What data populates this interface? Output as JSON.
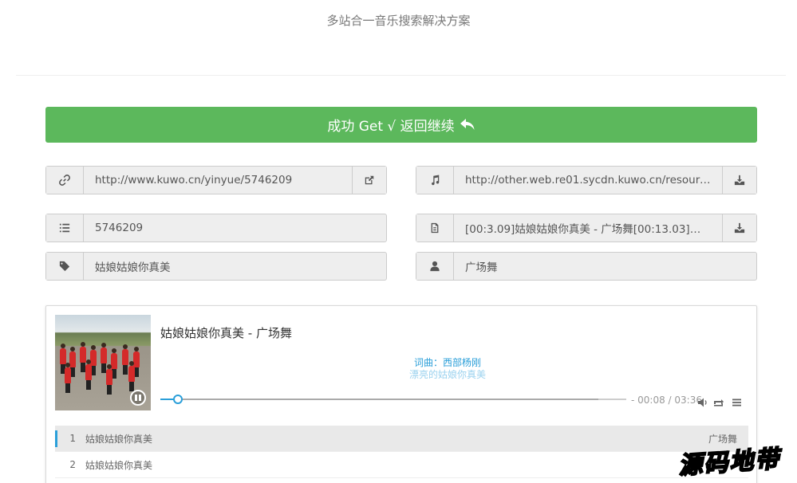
{
  "page": {
    "subtitle": "多站合一音乐搜索解决方案"
  },
  "success_button": {
    "label": "成功 Get √ 返回继续"
  },
  "fields": {
    "source_link": {
      "value": "http://www.kuwo.cn/yinyue/5746209"
    },
    "audio_url": {
      "value": "http://other.web.re01.sycdn.kuwo.cn/resource/n..."
    },
    "song_id": {
      "value": "5746209"
    },
    "lyrics": {
      "value": "[00:3.09]姑娘姑娘你真美 - 广场舞[00:13.03]词曲..."
    },
    "song_name": {
      "value": "姑娘姑娘你真美"
    },
    "artist": {
      "value": "广场舞"
    }
  },
  "player": {
    "title": "姑娘姑娘你真美 - 广场舞",
    "lyric_current": "词曲：西部杨刚",
    "lyric_next": "漂亮的姑娘你真美",
    "time": "- 00:08 / 03:36",
    "progress_played": 0.038,
    "progress_loaded": 0.94
  },
  "playlist": [
    {
      "num": "1",
      "title": "姑娘姑娘你真美",
      "artist": "广场舞",
      "active": true
    },
    {
      "num": "2",
      "title": "姑娘姑娘你真美",
      "artist": "",
      "active": false
    }
  ],
  "watermark": "源码地带",
  "colors": {
    "success": "#5cb85c",
    "accent": "#2b9fd9"
  },
  "icons": {
    "source_link": "link-icon",
    "source_link_action": "external-link-icon",
    "audio_url": "music-icon",
    "audio_url_action": "download-icon",
    "song_id": "list-icon",
    "lyrics": "file-icon",
    "lyrics_action": "download-icon",
    "song_name": "tag-icon",
    "artist": "user-icon"
  }
}
